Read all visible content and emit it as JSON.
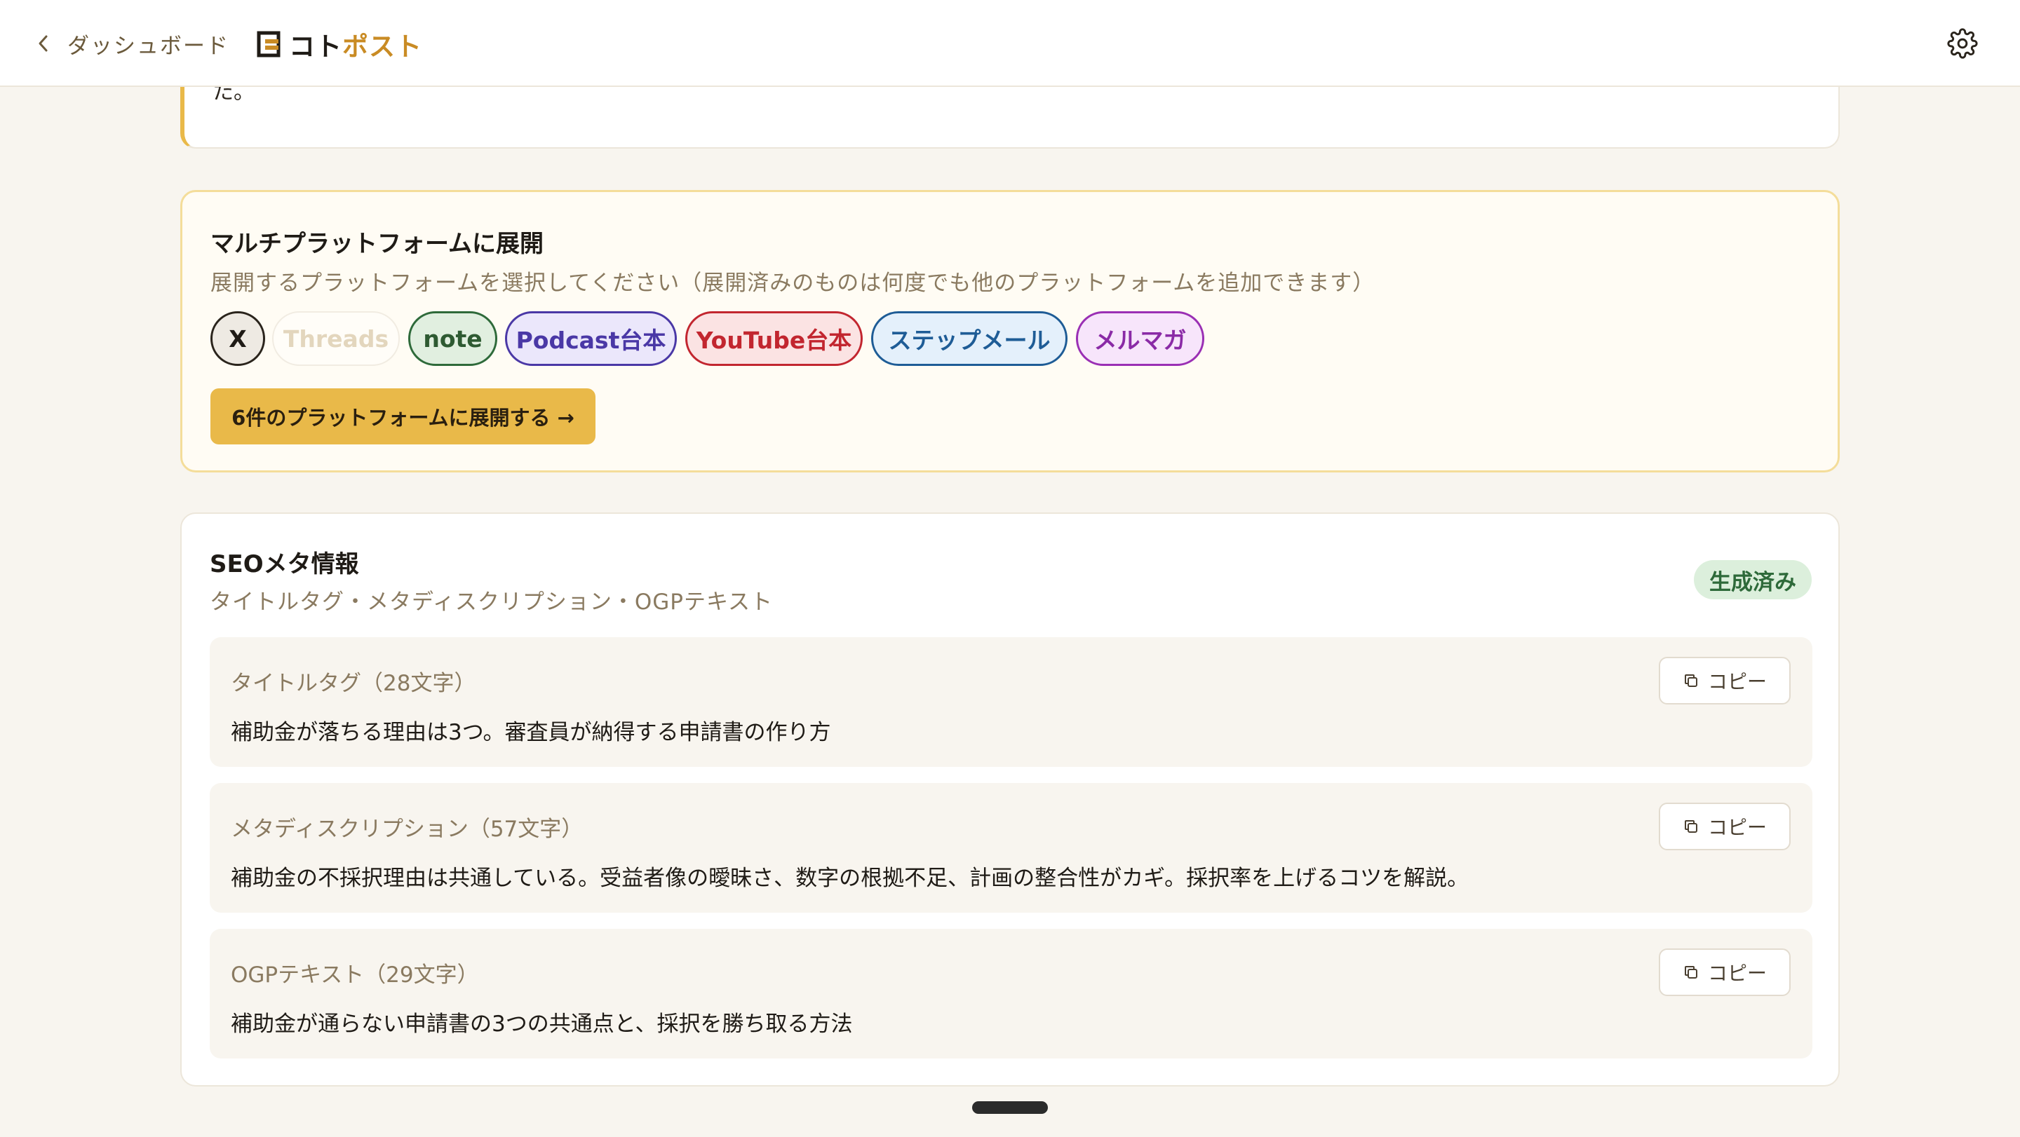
{
  "header": {
    "back_label": "ダッシュボード",
    "logo_part1": "コト",
    "logo_part2": "ポスト"
  },
  "previous_card": {
    "tail_text": "た。"
  },
  "multi_platform": {
    "title": "マルチプラットフォームに展開",
    "subtitle": "展開するプラットフォームを選択してください（展開済みのものは何度でも他のプラットフォームを追加できます）",
    "platforms": [
      {
        "label": "X",
        "selected": true
      },
      {
        "label": "Threads",
        "selected": false
      },
      {
        "label": "note",
        "selected": true
      },
      {
        "label": "Podcast台本",
        "selected": true
      },
      {
        "label": "YouTube台本",
        "selected": true
      },
      {
        "label": "ステップメール",
        "selected": true
      },
      {
        "label": "メルマガ",
        "selected": true
      }
    ],
    "expand_button": "6件のプラットフォームに展開する →"
  },
  "seo": {
    "title": "SEOメタ情報",
    "subtitle": "タイトルタグ・メタディスクリプション・OGPテキスト",
    "status_badge": "生成済み",
    "copy_label": "コピー",
    "items": [
      {
        "label": "タイトルタグ（28文字）",
        "value": "補助金が落ちる理由は3つ。審査員が納得する申請書の作り方"
      },
      {
        "label": "メタディスクリプション（57文字）",
        "value": "補助金の不採択理由は共通している。受益者像の曖昧さ、数字の根拠不足、計画の整合性がカギ。採択率を上げるコツを解説。"
      },
      {
        "label": "OGPテキスト（29文字）",
        "value": "補助金が通らない申請書の3つの共通点と、採択を勝ち取る方法"
      }
    ]
  },
  "colors": {
    "accent": "#e9b949",
    "background": "#f8f5ef",
    "brand_orange": "#c98b24",
    "badge_green": "#dcefdc"
  }
}
